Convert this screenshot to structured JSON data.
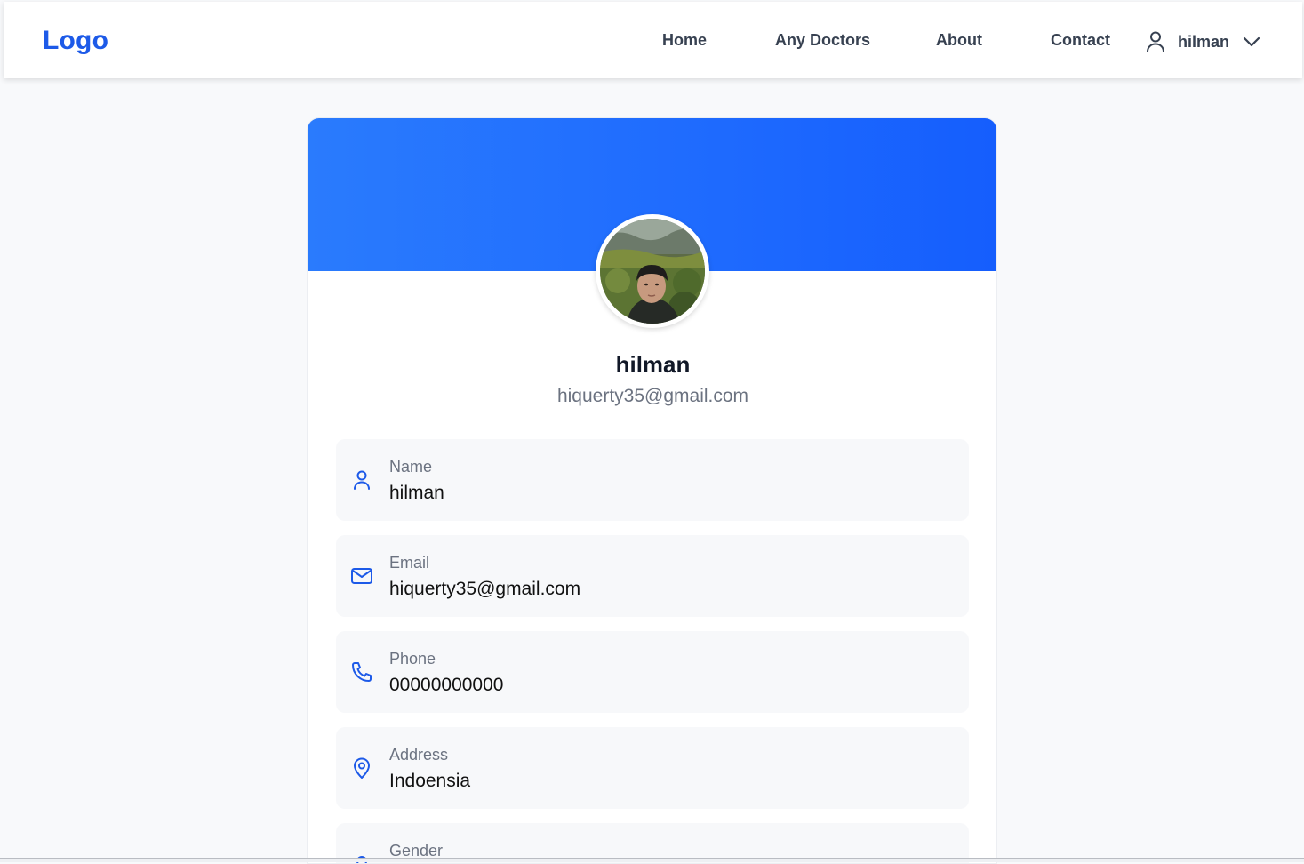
{
  "nav": {
    "logo": "Logo",
    "links": [
      "Home",
      "Any Doctors",
      "About",
      "Contact"
    ],
    "user_name": "hilman",
    "user_icon": "user-icon",
    "dropdown_icon": "chevron-down-icon"
  },
  "profile": {
    "name": "hilman",
    "email": "hiquerty35@gmail.com",
    "avatar": "profile-photo"
  },
  "fields": [
    {
      "label": "Name",
      "value": "hilman",
      "icon": "user-icon"
    },
    {
      "label": "Email",
      "value": "hiquerty35@gmail.com",
      "icon": "mail-icon"
    },
    {
      "label": "Phone",
      "value": "00000000000",
      "icon": "phone-icon"
    },
    {
      "label": "Address",
      "value": "Indoensia",
      "icon": "map-pin-icon"
    },
    {
      "label": "Gender",
      "value": "",
      "icon": "gender-icon"
    }
  ],
  "colors": {
    "accent": "#1d5ae8",
    "banner_start": "#2a7bfd",
    "banner_end": "#155efd",
    "page_bg": "#f8f9fb",
    "field_bg": "#f7f8fa"
  }
}
